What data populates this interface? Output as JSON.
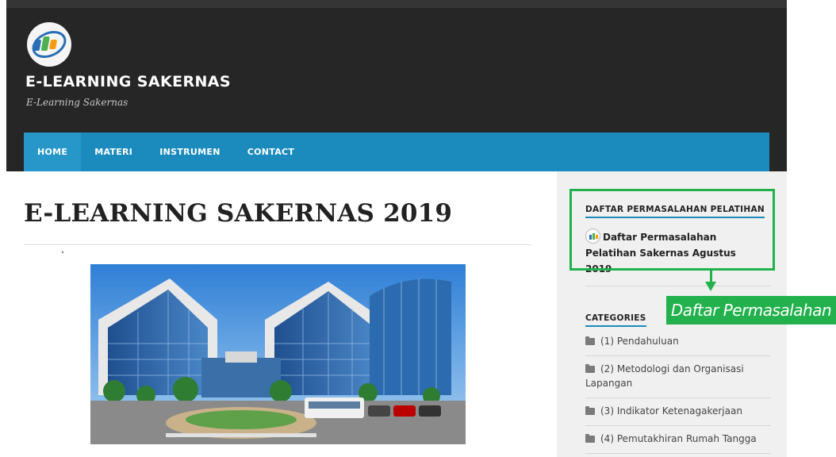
{
  "header": {
    "site_title": "E-LEARNING SAKERNAS",
    "tagline": "E-Learning Sakernas",
    "logo_icon": "bps-logo-icon"
  },
  "nav": {
    "items": [
      {
        "label": "HOME",
        "active": true
      },
      {
        "label": "MATERI",
        "active": false
      },
      {
        "label": "INSTRUMEN",
        "active": false
      },
      {
        "label": "CONTACT",
        "active": false
      }
    ]
  },
  "post": {
    "title": "E-LEARNING SAKERNAS 2019",
    "image_icon": "building-photo"
  },
  "sidebar": {
    "widget1": {
      "title": "DAFTAR PERMASALAHAN PELATIHAN",
      "link": "Daftar Permasalahan Pelatihan Sakernas Agustus 2019"
    },
    "categories": {
      "title": "CATEGORIES",
      "items": [
        "(1) Pendahuluan",
        "(2) Metodologi dan Organisasi Lapangan",
        "(3) Indikator Ketenagakerjaan",
        "(4) Pemutakhiran Rumah Tangga"
      ]
    }
  },
  "annotation": {
    "callout": "Daftar Permasalahan",
    "color": "#22b14c"
  },
  "colors": {
    "header_bg": "#262626",
    "nav_bg": "#1b8bbd",
    "sidebar_bg": "#f0f0f0"
  }
}
